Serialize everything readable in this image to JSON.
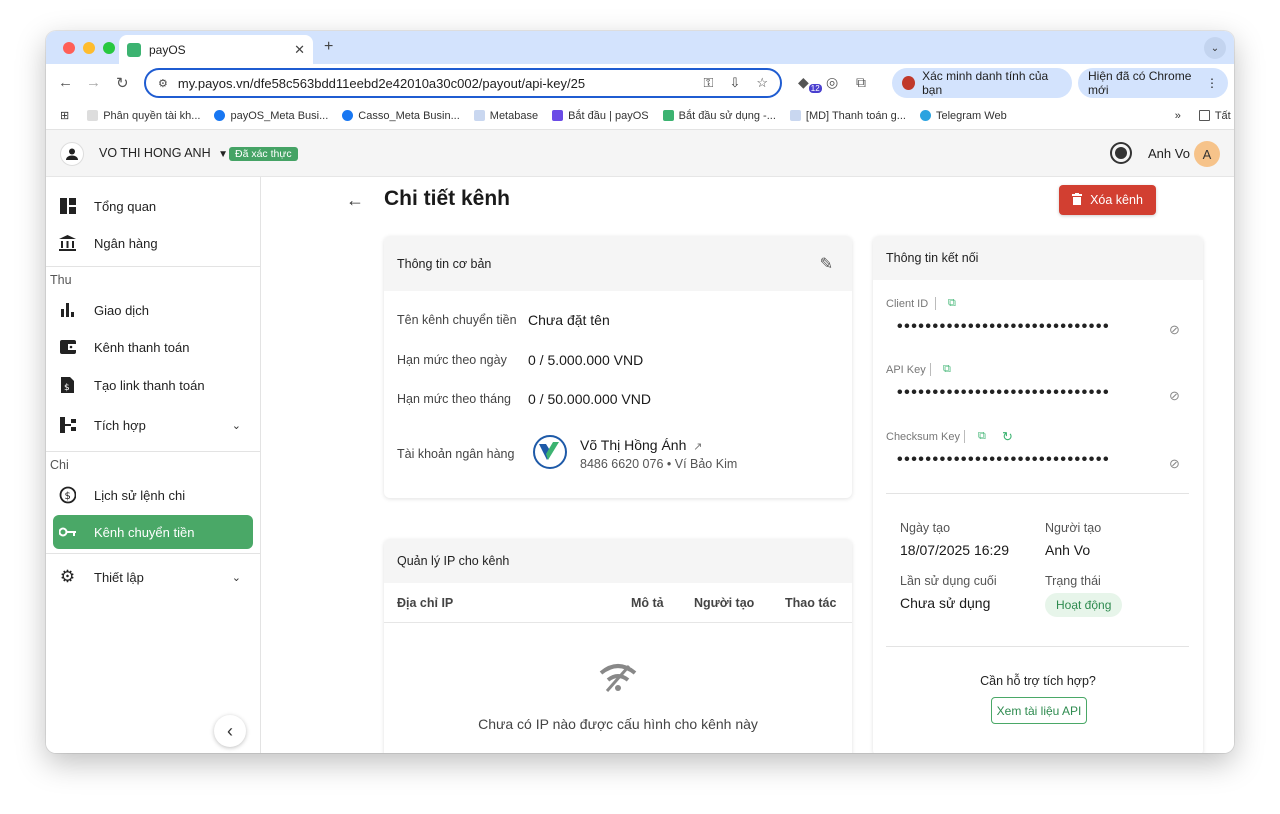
{
  "browser": {
    "tab_title": "payOS",
    "url": "my.payos.vn/dfe58c563bdd11eebd2e42010a30c002/payout/api-key/25",
    "ext_badge": "12",
    "identity_pill": "Xác minh danh tính của bạn",
    "update_pill": "Hiện đã có Chrome mới"
  },
  "bookmarks": {
    "items": [
      "Phân quyền tài kh...",
      "payOS_Meta Busi...",
      "Casso_Meta Busin...",
      "Metabase",
      "Bắt đầu | payOS",
      "Bắt đầu sử dụng -...",
      "[MD] Thanh toán g...",
      "Telegram Web"
    ],
    "more": "»",
    "all_bookmarks": "Tất cả dấu trang"
  },
  "header": {
    "org_name": "VO THI HONG ANH",
    "verified_badge": "Đã xác thực",
    "user_name": "Anh Vo",
    "user_initial": "A"
  },
  "sidebar": {
    "overview": "Tổng quan",
    "bank": "Ngân hàng",
    "section_in": "Thu",
    "transactions": "Giao dịch",
    "payment_channel": "Kênh thanh toán",
    "create_link": "Tạo link thanh toán",
    "integration": "Tích hợp",
    "section_out": "Chi",
    "payout_history": "Lịch sử lệnh chi",
    "transfer_channel": "Kênh chuyển tiền",
    "settings": "Thiết lập"
  },
  "page": {
    "title": "Chi tiết kênh",
    "delete_button": "Xóa kênh"
  },
  "basic_info": {
    "heading": "Thông tin cơ bản",
    "name_label": "Tên kênh chuyển tiền",
    "name_value": "Chưa đặt tên",
    "daily_label": "Hạn mức theo ngày",
    "daily_value": "0 / 5.000.000 VND",
    "monthly_label": "Hạn mức theo tháng",
    "monthly_value": "0 / 50.000.000 VND",
    "account_label": "Tài khoản ngân hàng",
    "account_name": "Võ Thị Hồng Ánh",
    "account_detail": "8486 6620 076 • Ví Bảo Kim"
  },
  "ip_card": {
    "heading": "Quản lý IP cho kênh",
    "col_ip": "Địa chỉ IP",
    "col_desc": "Mô tả",
    "col_creator": "Người tạo",
    "col_action": "Thao tác",
    "empty_title": "Chưa có IP nào được cấu hình cho kênh này"
  },
  "connection": {
    "heading": "Thông tin kết nối",
    "client_id_label": "Client ID",
    "api_key_label": "API Key",
    "checksum_label": "Checksum Key",
    "masked": "••••••••••••••••••••••••••••••",
    "created_label": "Ngày tạo",
    "created_value": "18/07/2025 16:29",
    "creator_label": "Người tạo",
    "creator_value": "Anh Vo",
    "last_used_label": "Lần sử dụng cuối",
    "last_used_value": "Chưa sử dụng",
    "status_label": "Trạng thái",
    "status_value": "Hoạt động",
    "help_text": "Cần hỗ trợ tích hợp?",
    "docs_button": "Xem tài liệu API"
  },
  "colors": {
    "brand_green": "#4aa867",
    "danger": "#d23f31",
    "chrome_blue": "#d3e3fd"
  }
}
